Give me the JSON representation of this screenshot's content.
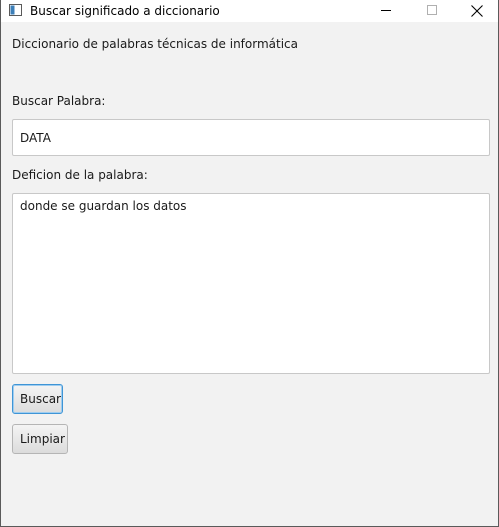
{
  "window": {
    "title": "Buscar significado a diccionario",
    "controls": [
      "minimize-icon",
      "maximize-icon",
      "close-icon"
    ]
  },
  "header": {
    "text": "Diccionario de palabras técnicas de informática"
  },
  "search": {
    "label": "Buscar Palabra:",
    "value": "DATA"
  },
  "definition": {
    "label": "Deficion de la palabra:",
    "value": "donde se guardan los datos"
  },
  "buttons": {
    "search_label": "Buscar",
    "clear_label": "Limpiar"
  },
  "colors": {
    "window_bg": "#f2f2f2",
    "titlebar_bg": "#ffffff",
    "focus_border": "#3f95d6"
  }
}
